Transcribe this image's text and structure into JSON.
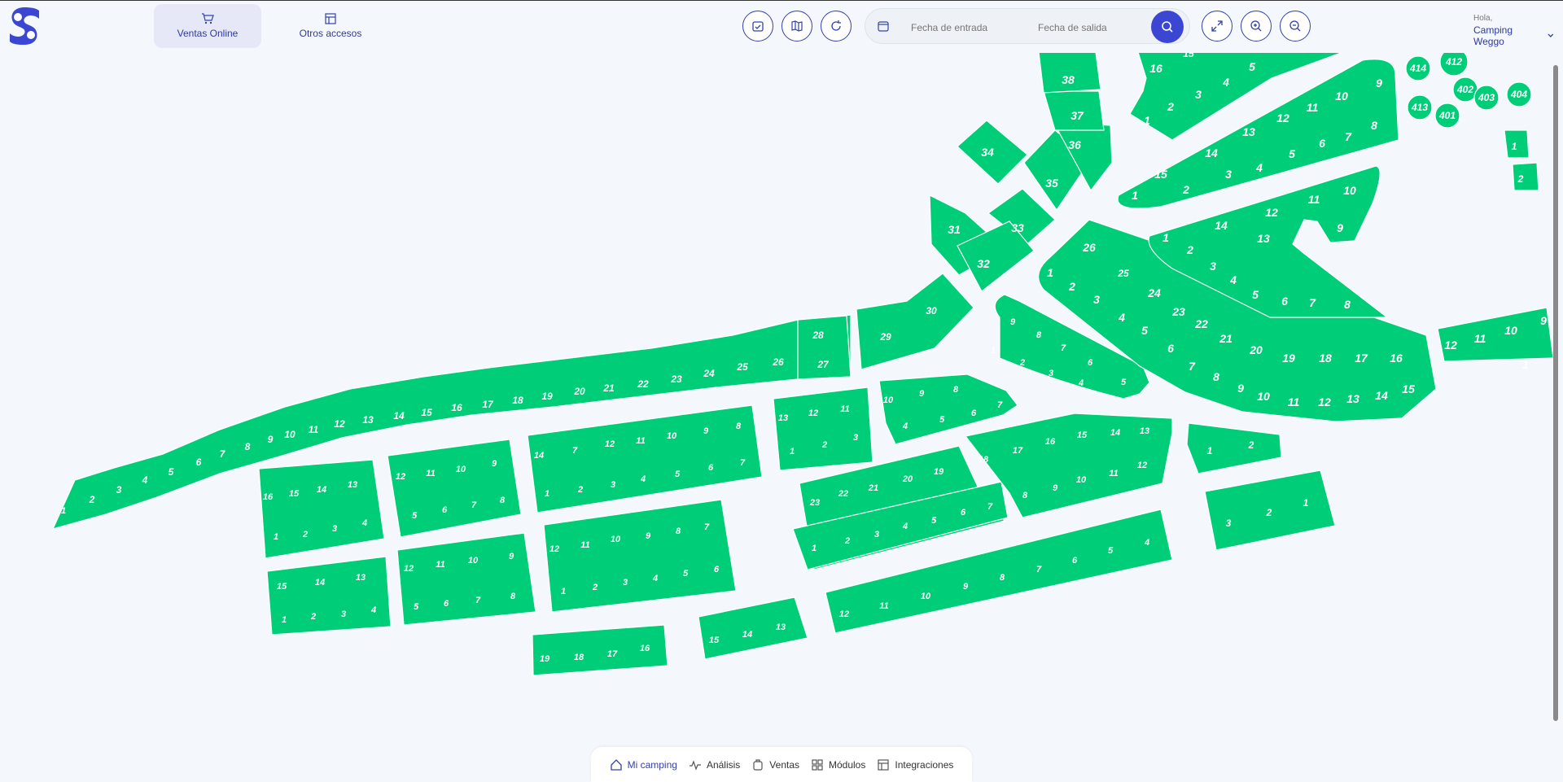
{
  "header": {
    "tabs": [
      {
        "label": "Ventas Online",
        "icon": "cart-icon",
        "active": true
      },
      {
        "label": "Otros accesos",
        "icon": "layout-icon",
        "active": false
      }
    ],
    "tools": [
      "calendar-check-icon",
      "map-icon",
      "refresh-icon"
    ],
    "date_from_placeholder": "Fecha de entrada",
    "date_to_placeholder": "Fecha de salida",
    "view_tools": [
      "expand-icon",
      "zoom-in-icon",
      "zoom-out-icon"
    ],
    "greeting": "Hola,",
    "user_name": "Camping Weggo",
    "accent": "#3b47d3"
  },
  "bottom_nav": {
    "items": [
      {
        "label": "Mi camping",
        "icon": "home-icon",
        "active": true
      },
      {
        "label": "Análisis",
        "icon": "pulse-icon",
        "active": false
      },
      {
        "label": "Ventas",
        "icon": "cart-box-icon",
        "active": false
      },
      {
        "label": "Módulos",
        "icon": "grid-icon",
        "active": false
      },
      {
        "label": "Integraciones",
        "icon": "board-icon",
        "active": false
      }
    ]
  },
  "map": {
    "plot_color": "#00cd78",
    "main_row": [
      "1",
      "2",
      "3",
      "4",
      "5",
      "6",
      "7",
      "8",
      "9",
      "10",
      "11",
      "12",
      "13",
      "14",
      "15",
      "16",
      "17",
      "18",
      "19",
      "20",
      "21",
      "22",
      "23",
      "24",
      "25",
      "26",
      "27",
      "28"
    ],
    "b1": [
      "16",
      "15",
      "14",
      "13",
      "1",
      "2",
      "3",
      "4"
    ],
    "b2": [
      "12",
      "11",
      "10",
      "9",
      "5",
      "6",
      "7",
      "8"
    ],
    "b3": [
      "15",
      "14",
      "13",
      "1",
      "2",
      "3",
      "4"
    ],
    "b4": [
      "12",
      "11",
      "10",
      "9",
      "5",
      "6",
      "7",
      "8"
    ],
    "b5": [
      "14",
      "7",
      "12",
      "11",
      "10",
      "9",
      "8",
      "1",
      "2",
      "3",
      "4",
      "5",
      "6",
      "7"
    ],
    "b6": [
      "12",
      "11",
      "10",
      "9",
      "8",
      "7",
      "1",
      "2",
      "3",
      "4",
      "5",
      "6"
    ],
    "b7": [
      "19",
      "18",
      "17",
      "16"
    ],
    "b8": [
      "15",
      "14",
      "13"
    ],
    "b9": [
      "13",
      "12",
      "11",
      "1",
      "2",
      "3"
    ],
    "b10": [
      "10",
      "9",
      "8",
      "4",
      "5",
      "6",
      "7"
    ],
    "b11": [
      "23",
      "22",
      "21",
      "20",
      "19",
      "1",
      "2",
      "3",
      "4",
      "5",
      "6",
      "7"
    ],
    "b12": [
      "18",
      "17",
      "16",
      "15",
      "14",
      "13",
      "8",
      "9",
      "10",
      "11",
      "12"
    ],
    "b13": [
      "12",
      "11",
      "10",
      "9",
      "8",
      "7",
      "6",
      "5",
      "4"
    ],
    "b14": [
      "1",
      "2"
    ],
    "b15": [
      "3",
      "2",
      "1"
    ],
    "b16": [
      "9",
      "8",
      "7",
      "6",
      "5",
      "1",
      "2",
      "3",
      "4"
    ],
    "mid": [
      "29",
      "30",
      "31",
      "33",
      "32",
      "34",
      "35",
      "36",
      "37",
      "38"
    ],
    "b17": [
      "26",
      "25",
      "24",
      "23",
      "22",
      "21",
      "20",
      "19",
      "18",
      "17",
      "16",
      "1",
      "2",
      "3",
      "4",
      "5",
      "6",
      "7",
      "8",
      "9",
      "10",
      "11",
      "12",
      "13",
      "14",
      "15"
    ],
    "b18": [
      "1",
      "2",
      "14",
      "3",
      "13",
      "4",
      "12",
      "5",
      "11",
      "6",
      "10",
      "7",
      "9",
      "8"
    ],
    "b19": [
      "15",
      "1",
      "2",
      "14",
      "3",
      "13",
      "4",
      "12",
      "5",
      "11",
      "6",
      "10",
      "7",
      "9",
      "8"
    ],
    "b20": [
      "16",
      "15",
      "5",
      "1",
      "2",
      "3",
      "4"
    ],
    "b21": [
      "414",
      "412",
      "402",
      "403",
      "404",
      "413",
      "401"
    ],
    "b22": [
      "12",
      "11",
      "10",
      "9",
      "1",
      "1",
      "2"
    ]
  }
}
